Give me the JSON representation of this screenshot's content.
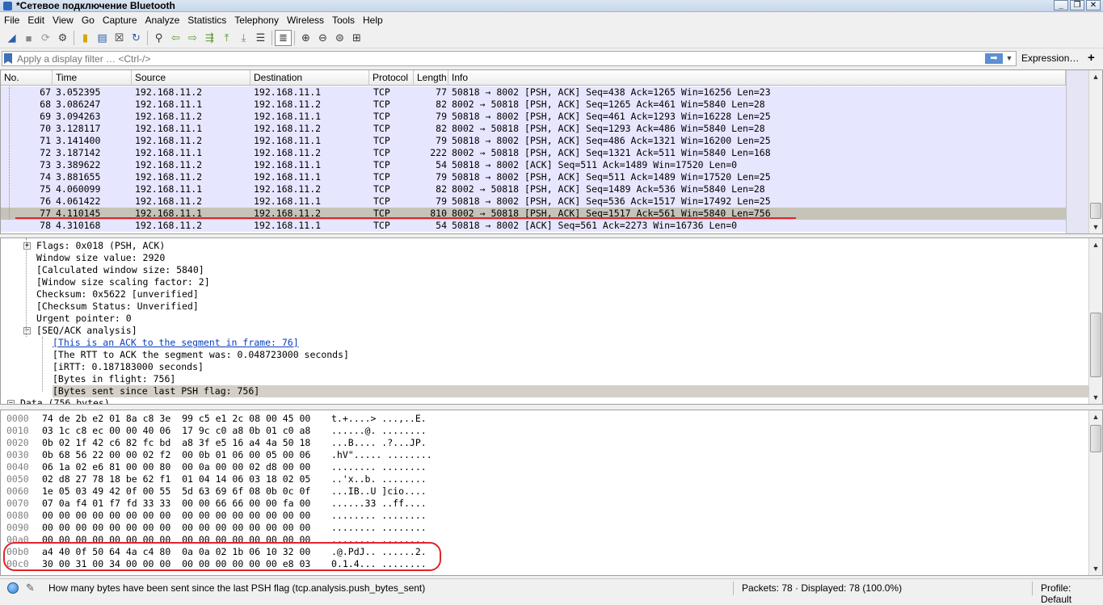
{
  "window": {
    "title": "*Сетевое подключение Bluetooth",
    "buttons": [
      "_",
      "❐",
      "✕"
    ]
  },
  "menu": [
    "File",
    "Edit",
    "View",
    "Go",
    "Capture",
    "Analyze",
    "Statistics",
    "Telephony",
    "Wireless",
    "Tools",
    "Help"
  ],
  "toolbar_icons": [
    "start-capture-icon",
    "stop-capture-icon",
    "restart-capture-icon",
    "capture-options-icon",
    "open-file-icon",
    "save-file-icon",
    "close-file-icon",
    "reload-file-icon",
    "find-packet-icon",
    "go-back-icon",
    "go-forward-icon",
    "go-to-packet-icon",
    "go-first-icon",
    "go-last-icon",
    "autoscroll-icon",
    "colorize-icon",
    "zoom-in-icon",
    "zoom-out-icon",
    "zoom-normal-icon",
    "resize-columns-icon"
  ],
  "filter": {
    "placeholder": "Apply a display filter … <Ctrl-/>",
    "expression_label": "Expression…",
    "plus_label": "+"
  },
  "packet_list": {
    "columns": [
      "No.",
      "Time",
      "Source",
      "Destination",
      "Protocol",
      "Length",
      "Info"
    ],
    "rows": [
      [
        "67",
        "3.052395",
        "192.168.11.2",
        "192.168.11.1",
        "TCP",
        "77",
        "50818 → 8002 [PSH, ACK] Seq=438 Ack=1265 Win=16256 Len=23"
      ],
      [
        "68",
        "3.086247",
        "192.168.11.1",
        "192.168.11.2",
        "TCP",
        "82",
        "8002 → 50818 [PSH, ACK] Seq=1265 Ack=461 Win=5840 Len=28"
      ],
      [
        "69",
        "3.094263",
        "192.168.11.2",
        "192.168.11.1",
        "TCP",
        "79",
        "50818 → 8002 [PSH, ACK] Seq=461 Ack=1293 Win=16228 Len=25"
      ],
      [
        "70",
        "3.128117",
        "192.168.11.1",
        "192.168.11.2",
        "TCP",
        "82",
        "8002 → 50818 [PSH, ACK] Seq=1293 Ack=486 Win=5840 Len=28"
      ],
      [
        "71",
        "3.141400",
        "192.168.11.2",
        "192.168.11.1",
        "TCP",
        "79",
        "50818 → 8002 [PSH, ACK] Seq=486 Ack=1321 Win=16200 Len=25"
      ],
      [
        "72",
        "3.187142",
        "192.168.11.1",
        "192.168.11.2",
        "TCP",
        "222",
        "8002 → 50818 [PSH, ACK] Seq=1321 Ack=511 Win=5840 Len=168"
      ],
      [
        "73",
        "3.389622",
        "192.168.11.2",
        "192.168.11.1",
        "TCP",
        "54",
        "50818 → 8002 [ACK] Seq=511 Ack=1489 Win=17520 Len=0"
      ],
      [
        "74",
        "3.881655",
        "192.168.11.2",
        "192.168.11.1",
        "TCP",
        "79",
        "50818 → 8002 [PSH, ACK] Seq=511 Ack=1489 Win=17520 Len=25"
      ],
      [
        "75",
        "4.060099",
        "192.168.11.1",
        "192.168.11.2",
        "TCP",
        "82",
        "8002 → 50818 [PSH, ACK] Seq=1489 Ack=536 Win=5840 Len=28"
      ],
      [
        "76",
        "4.061422",
        "192.168.11.2",
        "192.168.11.1",
        "TCP",
        "79",
        "50818 → 8002 [PSH, ACK] Seq=536 Ack=1517 Win=17492 Len=25"
      ],
      [
        "77",
        "4.110145",
        "192.168.11.1",
        "192.168.11.2",
        "TCP",
        "810",
        "8002 → 50818 [PSH, ACK] Seq=1517 Ack=561 Win=5840 Len=756"
      ],
      [
        "78",
        "4.310168",
        "192.168.11.2",
        "192.168.11.1",
        "TCP",
        "54",
        "50818 → 8002 [ACK] Seq=561 Ack=2273 Win=16736 Len=0"
      ]
    ],
    "selected_row": "77"
  },
  "details": {
    "rows": [
      {
        "text": "Flags: 0x018 (PSH, ACK)",
        "expander": "+"
      },
      {
        "text": "Window size value: 2920"
      },
      {
        "text": "[Calculated window size: 5840]"
      },
      {
        "text": "[Window size scaling factor: 2]"
      },
      {
        "text": "Checksum: 0x5622 [unverified]"
      },
      {
        "text": "[Checksum Status: Unverified]"
      },
      {
        "text": "Urgent pointer: 0"
      },
      {
        "text": "[SEQ/ACK analysis]",
        "expander": "−"
      },
      {
        "text": "[This is an ACK to the segment in frame: 76]",
        "link": true
      },
      {
        "text": "[The RTT to ACK the segment was: 0.048723000 seconds]"
      },
      {
        "text": "[iRTT: 0.187183000 seconds]"
      },
      {
        "text": "[Bytes in flight: 756]"
      },
      {
        "text": "[Bytes sent since last PSH flag: 756]",
        "selected": true
      },
      {
        "text": "Data (756 bytes)",
        "expander": "−"
      }
    ]
  },
  "bytes": {
    "rows": [
      [
        "0000",
        "74 de 2b e2 01 8a c8 3e  99 c5 e1 2c 08 00 45 00",
        "t.+....> ...,..E."
      ],
      [
        "0010",
        "03 1c c8 ec 00 00 40 06  17 9c c0 a8 0b 01 c0 a8",
        "......@. ........"
      ],
      [
        "0020",
        "0b 02 1f 42 c6 82 fc bd  a8 3f e5 16 a4 4a 50 18",
        "...B.... .?...JP."
      ],
      [
        "0030",
        "0b 68 56 22 00 00 02 f2  00 0b 01 06 00 05 00 06",
        ".hV\"..... ........"
      ],
      [
        "0040",
        "06 1a 02 e6 81 00 00 80  00 0a 00 00 02 d8 00 00",
        "........ ........"
      ],
      [
        "0050",
        "02 d8 27 78 18 be 62 f1  01 04 14 06 03 18 02 05",
        "..'x..b. ........"
      ],
      [
        "0060",
        "1e 05 03 49 42 0f 00 55  5d 63 69 6f 08 0b 0c 0f",
        "...IB..U ]cio...."
      ],
      [
        "0070",
        "07 0a f4 01 f7 fd 33 33  00 00 66 66 00 00 fa 00",
        "......33 ..ff...."
      ],
      [
        "0080",
        "00 00 00 00 00 00 00 00  00 00 00 00 00 00 00 00",
        "........ ........"
      ],
      [
        "0090",
        "00 00 00 00 00 00 00 00  00 00 00 00 00 00 00 00",
        "........ ........"
      ],
      [
        "00a0",
        "00 00 00 00 00 00 00 00  00 00 00 00 00 00 00 00",
        "........ ........"
      ],
      [
        "00b0",
        "a4 40 0f 50 64 4a c4 80  0a 0a 02 1b 06 10 32 00",
        ".@.PdJ.. ......2."
      ],
      [
        "00c0",
        "30 00 31 00 34 00 00 00  00 00 00 00 00 00 e8 03",
        "0.1.4... ........"
      ]
    ]
  },
  "status": {
    "message": "How many bytes have been sent since the last PSH flag (tcp.analysis.push_bytes_sent)",
    "packets": "Packets: 78 · Displayed: 78 (100.0%)",
    "profile": "Profile: Default"
  },
  "colors": {
    "row_tcp": "#e7e6ff",
    "row_selected": "#c6c3b9",
    "annotation_red": "#e0252b"
  }
}
